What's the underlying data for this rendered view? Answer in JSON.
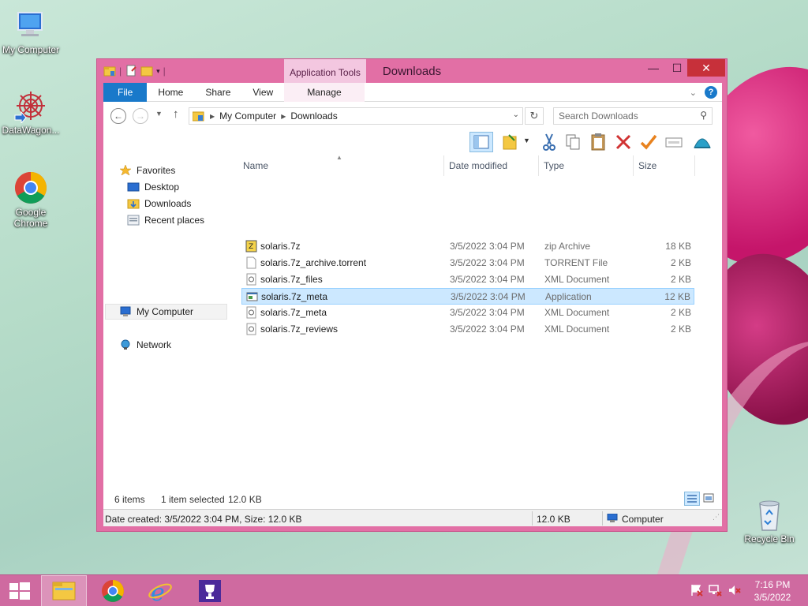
{
  "desktop": {
    "icons": [
      {
        "label": "My Computer"
      },
      {
        "label": "DataWagon..."
      },
      {
        "label": "Google Chrome"
      },
      {
        "label": "Recycle Bin"
      }
    ]
  },
  "window": {
    "title": "Downloads",
    "context_tab_group": "Application Tools",
    "ribbon_tabs": [
      "File",
      "Home",
      "Share",
      "View",
      "Manage"
    ],
    "address": {
      "crumbs": [
        "My Computer",
        "Downloads"
      ]
    },
    "search": {
      "placeholder": "Search Downloads"
    },
    "nav": {
      "favorites": "Favorites",
      "desktop": "Desktop",
      "downloads": "Downloads",
      "recent": "Recent places",
      "computer": "My Computer",
      "network": "Network"
    },
    "columns": {
      "name": "Name",
      "date": "Date modified",
      "type": "Type",
      "size": "Size"
    },
    "files": [
      {
        "name": "solaris.7z",
        "date": "3/5/2022 3:04 PM",
        "type": "zip Archive",
        "size": "18 KB",
        "icon": "zip-icon"
      },
      {
        "name": "solaris.7z_archive.torrent",
        "date": "3/5/2022 3:04 PM",
        "type": "TORRENT File",
        "size": "2 KB",
        "icon": "torrent-file-icon"
      },
      {
        "name": "solaris.7z_files",
        "date": "3/5/2022 3:04 PM",
        "type": "XML Document",
        "size": "2 KB",
        "icon": "xml-file-icon"
      },
      {
        "name": "solaris.7z_meta",
        "date": "3/5/2022 3:04 PM",
        "type": "Application",
        "size": "12 KB",
        "icon": "application-icon"
      },
      {
        "name": "solaris.7z_meta",
        "date": "3/5/2022 3:04 PM",
        "type": "XML Document",
        "size": "2 KB",
        "icon": "xml-file-icon"
      },
      {
        "name": "solaris.7z_reviews",
        "date": "3/5/2022 3:04 PM",
        "type": "XML Document",
        "size": "2 KB",
        "icon": "xml-file-icon"
      }
    ],
    "status": {
      "items": "6 items",
      "selected": "1 item selected",
      "selected_size": "12.0 KB",
      "details": "Date created: 3/5/2022 3:04 PM, Size: 12.0 KB",
      "size": "12.0 KB",
      "location": "Computer"
    }
  },
  "taskbar": {
    "clock_time": "7:16 PM",
    "clock_date": "3/5/2022"
  },
  "colors": {
    "window_frame": "#e26fa5",
    "taskbar": "#cf6aa0",
    "file_tab": "#1979ca",
    "selection": "#cce8ff",
    "close_button": "#c7303a"
  }
}
